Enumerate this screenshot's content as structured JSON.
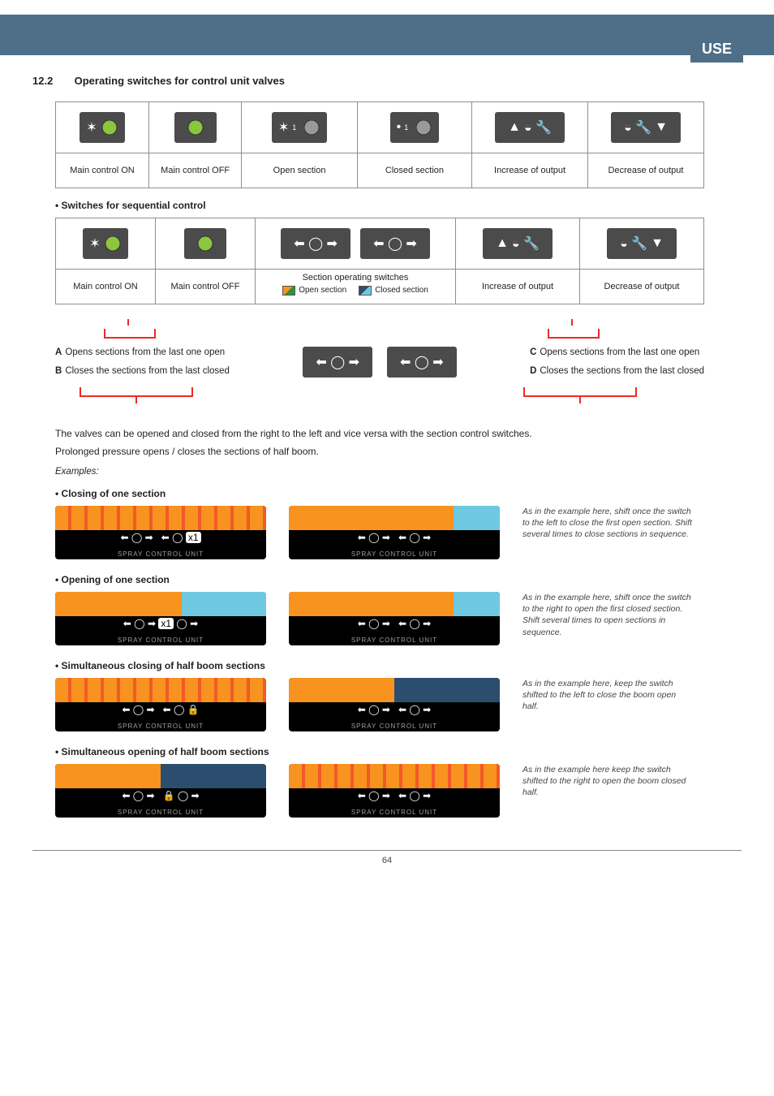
{
  "header": {
    "tag": "USE"
  },
  "section": {
    "number": "12.2",
    "title": "Operating switches for control unit valves"
  },
  "table1": {
    "cells": [
      "Main control ON",
      "Main control OFF",
      "Open section",
      "Closed section",
      "Increase of output",
      "Decrease of output"
    ]
  },
  "seq_heading": "• Switches for sequential control",
  "table2": {
    "top_span_label": "Section operating switches",
    "legend_open": "Open section",
    "legend_closed": "Closed section",
    "cells": [
      "Main control ON",
      "Main control OFF",
      "Increase of output",
      "Decrease of output"
    ]
  },
  "callouts": {
    "A": "Opens sections from the last one open",
    "B": "Closes the sections from the last closed",
    "C": "Opens sections from the last one open",
    "D": "Closes the sections from the last closed"
  },
  "explain": {
    "line1": "The valves can be opened and closed from the right to the left and vice versa with the section control switches.",
    "line2": "Prolonged pressure opens / closes the sections of half boom.",
    "examples_label": "Examples:"
  },
  "examples": [
    {
      "heading": "• Closing of one section",
      "panel_text": "x1",
      "caption": "As in the example here, shift once the switch to the left to close the first open section. Shift several times to close sections in sequence."
    },
    {
      "heading": "• Opening of one section",
      "panel_text": "x1",
      "caption": "As in the example here, shift once the switch to the right to open the first closed section. Shift several times to open sections in sequence."
    },
    {
      "heading": "• Simultaneous closing of half boom sections",
      "panel_text": "",
      "caption": "As in the example here, keep the switch shifted to the left to close the boom open half."
    },
    {
      "heading": "• Simultaneous opening of half boom sections",
      "panel_text": "",
      "caption": "As in the example here keep the switch shifted to the right to open the boom closed half."
    }
  ],
  "panel_label": "SPRAY CONTROL UNIT",
  "page_number": "64"
}
